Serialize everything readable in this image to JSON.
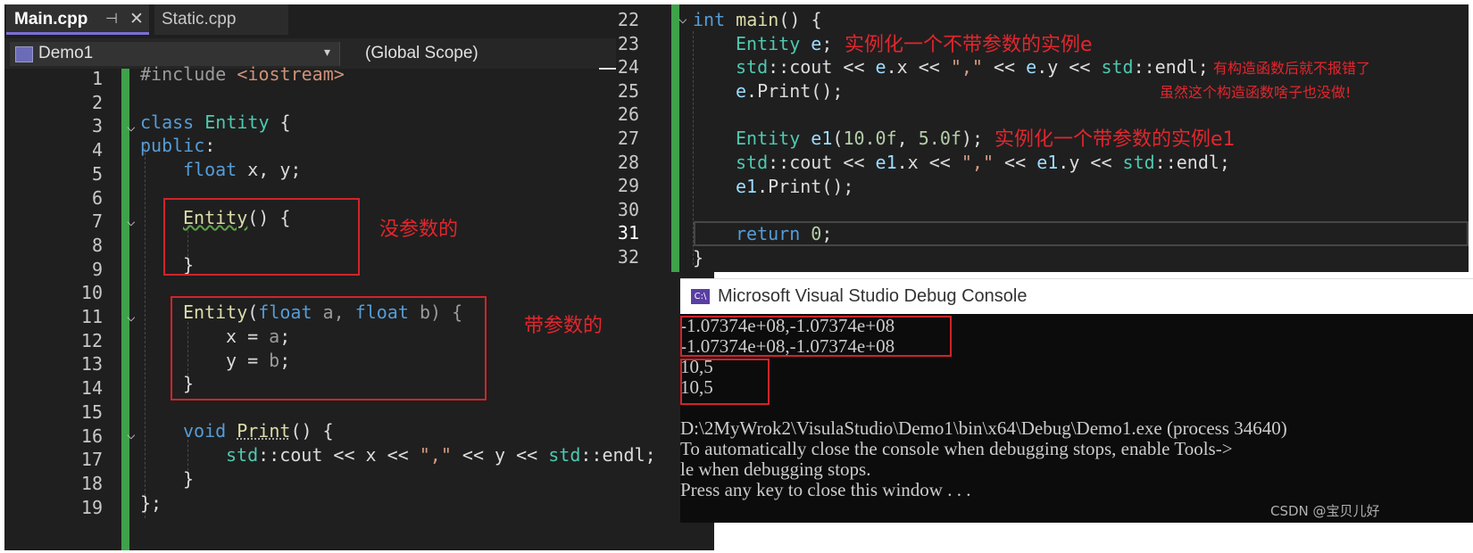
{
  "tabs": {
    "main": "Main.cpp",
    "main_pin": "⊣",
    "main_close": "✕",
    "static": "Static.cpp"
  },
  "nav": {
    "project": "Demo1",
    "scope": "(Global Scope)",
    "caret": "▾"
  },
  "left_lines": [
    "1",
    "2",
    "3",
    "4",
    "5",
    "6",
    "7",
    "8",
    "9",
    "10",
    "11",
    "12",
    "13",
    "14",
    "15",
    "16",
    "17",
    "18",
    "19"
  ],
  "right_lines": [
    "22",
    "23",
    "24",
    "25",
    "26",
    "27",
    "28",
    "29",
    "30",
    "31",
    "32"
  ],
  "code": {
    "include_kw": "#include ",
    "include_hdr": "<iostream>",
    "class_kw": "class ",
    "class_name": "Entity",
    "brace_open": " {",
    "public_kw": "public",
    "colon": ":",
    "float_kw": "float",
    "xy_decl": " x, y;",
    "ctor_name": "Entity",
    "ctor_tail": "() {",
    "brace_close": "}",
    "ctor2_name": "Entity",
    "paren_open": "(",
    "float_a": "float",
    "a_var": " a, ",
    "float_b": "float",
    "b_var": " b) {",
    "x_assign": "x = ",
    "a_ref": "a",
    "semi": ";",
    "y_assign": "y = ",
    "b_ref": "b",
    "void_kw": "void ",
    "print_name": "Print",
    "print_tail": "() {",
    "std": "std",
    "cout_line": "::cout << x << ",
    "comma_str": "\",\"",
    "cout_mid": " << y << ",
    "std2": "std",
    "endl": "::endl;",
    "class_end": "};",
    "int_kw": "int ",
    "main_name": "main",
    "main_tail": "() {",
    "entity_e": "Entity ",
    "e_var": "e",
    "semi2": ";",
    "cout_e_std": "std",
    "cout_e": "::cout << ",
    "e1": "e",
    "dotx": ".x << ",
    "comma_str2": "\",\"",
    "lshift": " << ",
    "e2": "e",
    "doty": ".y << ",
    "std3": "std",
    "endl2": "::endl;",
    "e_print_var": "e",
    "e_print": ".Print();",
    "entity_e1": "Entity ",
    "e1_var": "e1",
    "e1_args_open": "(",
    "num10": "10.0f",
    "comma_sp": ", ",
    "num5": "5.0f",
    "e1_args_close": ");",
    "cout_e1_std": "std",
    "cout_e1": "::cout << ",
    "e1a": "e1",
    "e1x": ".x << ",
    "comma_str3": "\",\"",
    "lshift2": " << ",
    "e1b": "e1",
    "e1y": ".y << ",
    "std4": "std",
    "endl3": "::endl;",
    "e1_print_var": "e1",
    "e1_print": ".Print();",
    "return_kw": "return ",
    "zero": "0",
    "semi3": ";",
    "main_end": "}"
  },
  "annotations": {
    "no_param": "没参数的",
    "with_param": "带参数的",
    "inst_e": "实例化一个不带参数的实例e",
    "no_error": "有构造函数后就不报错了",
    "useless": "虽然这个构造函数啥子也没做!",
    "inst_e1": "实例化一个带参数的实例e1"
  },
  "console": {
    "title": "Microsoft Visual Studio Debug Console",
    "icon": "C:\\",
    "lines": [
      "-1.07374e+08,-1.07374e+08",
      "-1.07374e+08,-1.07374e+08",
      "10,5",
      "10,5",
      "",
      "D:\\2MyWrok2\\VisulaStudio\\Demo1\\bin\\x64\\Debug\\Demo1.exe (process 34640)",
      "To automatically close the console when debugging stops, enable Tools->",
      "le when debugging stops.",
      "Press any key to close this window . . ."
    ]
  },
  "watermark": "CSDN @宝贝儿好",
  "colors": {
    "editor_bg": "#1f1f1f",
    "gutter_green": "#3fa24a",
    "keyword": "#569cd6",
    "type": "#4ec9b0",
    "function": "#dcdcaa",
    "annotation_red": "#e3262d",
    "console_bg": "#0c0c0c"
  }
}
